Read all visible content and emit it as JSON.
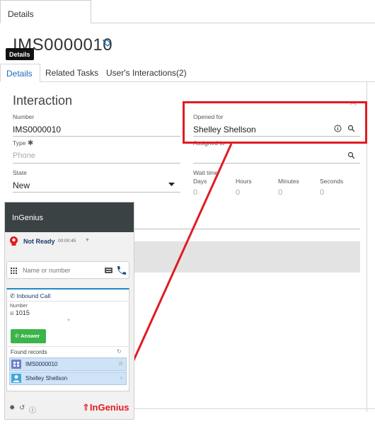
{
  "top_tab": {
    "label": "Details"
  },
  "record": {
    "number": "IMS0000010",
    "tooltip": "Details"
  },
  "subtabs": [
    "Details",
    "Related Tasks",
    "User's Interactions(2)"
  ],
  "section": {
    "title": "Interaction"
  },
  "fields": {
    "number": {
      "label": "Number",
      "value": "IMS0000010"
    },
    "opened_for": {
      "label": "Opened for",
      "value": "Shelley Shellson"
    },
    "type": {
      "label": "Type",
      "required_mark": "✱",
      "placeholder": "Phone"
    },
    "assigned_to": {
      "label": "Assigned to",
      "value": ""
    },
    "state": {
      "label": "State",
      "value": "New"
    },
    "wait_time": {
      "label": "Wait time",
      "columns": [
        "Days",
        "Hours",
        "Minutes",
        "Seconds"
      ],
      "values": [
        "0",
        "0",
        "0",
        "0"
      ]
    }
  },
  "ingenius": {
    "title": "InGenius",
    "status": "Not Ready",
    "timer": "00:00:45",
    "search_placeholder": "Name or number",
    "inbound_call_label": "Inbound Call",
    "number_label": "Number",
    "number_value": "1015",
    "answer_label": "Answer",
    "found_records_label": "Found records",
    "records": [
      {
        "label": "IMS0000010",
        "icon": "record-icon"
      },
      {
        "label": "Shelley Shellson",
        "icon": "user-icon"
      }
    ],
    "brand": "InGenius"
  },
  "colors": {
    "highlight": "#e11b22",
    "ingenius_header": "#3a4244",
    "answer_button": "#3bb54a",
    "record_row": "#cfe3f6",
    "active_tab": "#1f6bb7"
  }
}
